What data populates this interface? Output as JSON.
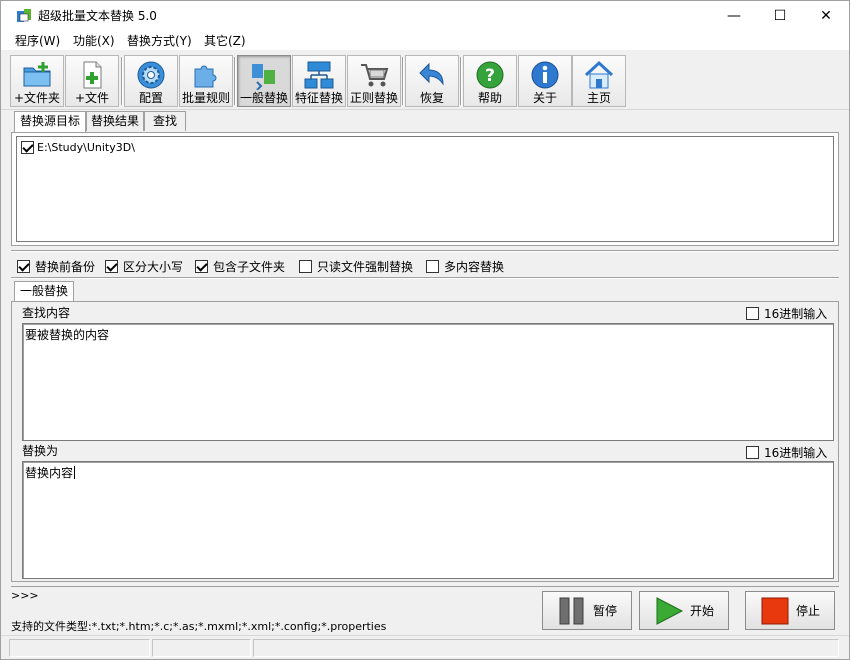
{
  "window": {
    "title": "超级批量文本替换 5.0",
    "controls": {
      "minimize": "—",
      "maximize": "☐",
      "close": "✕"
    }
  },
  "menu": [
    {
      "label": "程序(W)"
    },
    {
      "label": "功能(X)"
    },
    {
      "label": "替换方式(Y)"
    },
    {
      "label": "其它(Z)"
    }
  ],
  "toolbar": [
    {
      "label": "+文件夹",
      "icon": "folder-add-icon"
    },
    {
      "label": "+文件",
      "icon": "file-add-icon"
    },
    {
      "label": "配置",
      "icon": "gear-icon"
    },
    {
      "label": "批量规则",
      "icon": "puzzle-icon"
    },
    {
      "label": "一般替换",
      "icon": "swap-icon",
      "active": true
    },
    {
      "label": "特征替换",
      "icon": "network-icon"
    },
    {
      "label": "正则替换",
      "icon": "cart-icon"
    },
    {
      "label": "恢复",
      "icon": "undo-arrow-icon"
    },
    {
      "label": "帮助",
      "icon": "help-icon"
    },
    {
      "label": "关于",
      "icon": "info-icon"
    },
    {
      "label": "主页",
      "icon": "home-icon"
    }
  ],
  "tabs_top": [
    {
      "label": "替换源目标",
      "active": true
    },
    {
      "label": "替换结果"
    },
    {
      "label": "查找"
    }
  ],
  "targets": [
    {
      "path": "E:\\Study\\Unity3D\\",
      "checked": true
    }
  ],
  "options": [
    {
      "label": "替换前备份",
      "checked": true
    },
    {
      "label": "区分大小写",
      "checked": true
    },
    {
      "label": "包含子文件夹",
      "checked": true
    },
    {
      "label": "只读文件强制替换",
      "checked": false
    },
    {
      "label": "多内容替换",
      "checked": false
    }
  ],
  "tabs_mid": [
    {
      "label": "一般替换",
      "active": true
    }
  ],
  "find": {
    "label": "查找内容",
    "hex_label": "16进制输入",
    "hex_checked": false,
    "value": "要被替换的内容"
  },
  "replace": {
    "label": "替换为",
    "hex_label": "16进制输入",
    "hex_checked": false,
    "value": "替换内容"
  },
  "log": {
    "prompt": ">>>"
  },
  "supported_types": "支持的文件类型:*.txt;*.htm;*.c;*.as;*.mxml;*.xml;*.config;*.properties",
  "controls": {
    "pause_label": "暂停",
    "start_label": "开始",
    "stop_label": "停止"
  },
  "colors": {
    "start_green": "#3aaa35",
    "stop_red": "#e8380d",
    "pause_gray": "#6f6f6f"
  }
}
